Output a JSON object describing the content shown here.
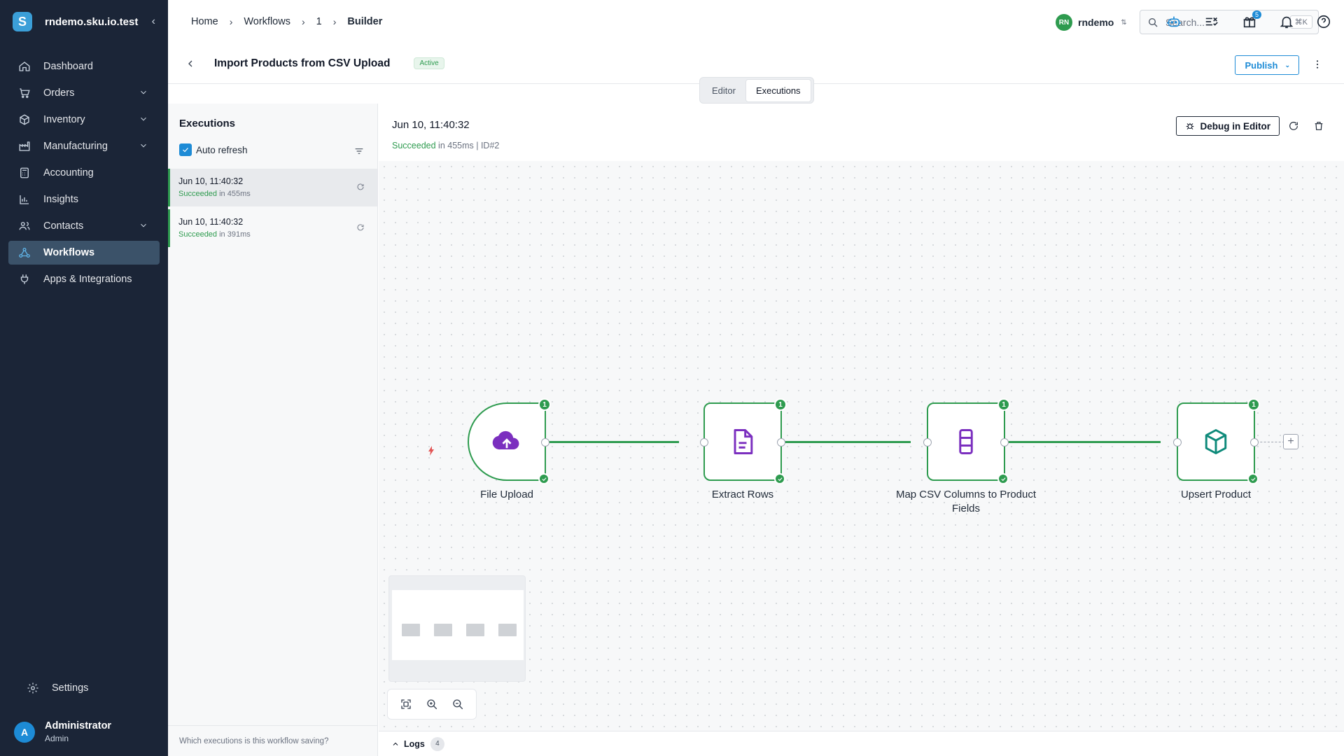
{
  "app": {
    "domain": "rndemo.sku.io.test"
  },
  "sidebar": {
    "items": [
      {
        "label": "Dashboard",
        "icon": "home-icon"
      },
      {
        "label": "Orders",
        "icon": "cart-icon"
      },
      {
        "label": "Inventory",
        "icon": "box-icon"
      },
      {
        "label": "Manufacturing",
        "icon": "factory-icon"
      },
      {
        "label": "Accounting",
        "icon": "calculator-icon"
      },
      {
        "label": "Insights",
        "icon": "bar-chart-icon"
      },
      {
        "label": "Contacts",
        "icon": "users-icon"
      },
      {
        "label": "Workflows",
        "icon": "workflow-icon"
      },
      {
        "label": "Apps & Integrations",
        "icon": "plug-icon"
      }
    ],
    "settings": "Settings",
    "user": {
      "initial": "A",
      "name": "Administrator",
      "role": "Admin"
    }
  },
  "breadcrumb": [
    "Home",
    "Workflows",
    "1",
    "Builder"
  ],
  "org": {
    "initials": "RN",
    "name": "rndemo"
  },
  "search": {
    "placeholder": "Search...",
    "shortcut": "⌘K"
  },
  "notifications": {
    "gift_count": "5"
  },
  "workflow": {
    "title": "Import Products from CSV Upload",
    "status": "Active",
    "publish_label": "Publish"
  },
  "tabs": [
    "Editor",
    "Executions"
  ],
  "executions": {
    "title": "Executions",
    "auto_refresh": "Auto refresh",
    "items": [
      {
        "date": "Jun 10, 11:40:32",
        "status": "Succeeded",
        "duration": "in 455ms"
      },
      {
        "date": "Jun 10, 11:40:32",
        "status": "Succeeded",
        "duration": "in 391ms"
      }
    ],
    "footer": "Which executions is this workflow saving?"
  },
  "detail": {
    "date": "Jun 10, 11:40:32",
    "status": "Succeeded",
    "meta": "in 455ms | ID#2",
    "debug_label": "Debug in Editor"
  },
  "nodes": [
    {
      "label": "File Upload",
      "count": "1",
      "icon": "cloud-upload-icon",
      "color": "#7b2fbf"
    },
    {
      "label": "Extract Rows",
      "count": "1",
      "icon": "document-icon",
      "color": "#7b2fbf"
    },
    {
      "label": "Map CSV Columns to Product Fields",
      "count": "1",
      "icon": "database-icon",
      "color": "#7b2fbf"
    },
    {
      "label": "Upsert Product",
      "count": "1",
      "icon": "cube-icon",
      "color": "#0e8a7a"
    }
  ],
  "logs": {
    "label": "Logs",
    "count": "4"
  },
  "colors": {
    "success": "#2e9b4f",
    "accent": "#1d8bd6",
    "sidebar": "#1b2537"
  }
}
